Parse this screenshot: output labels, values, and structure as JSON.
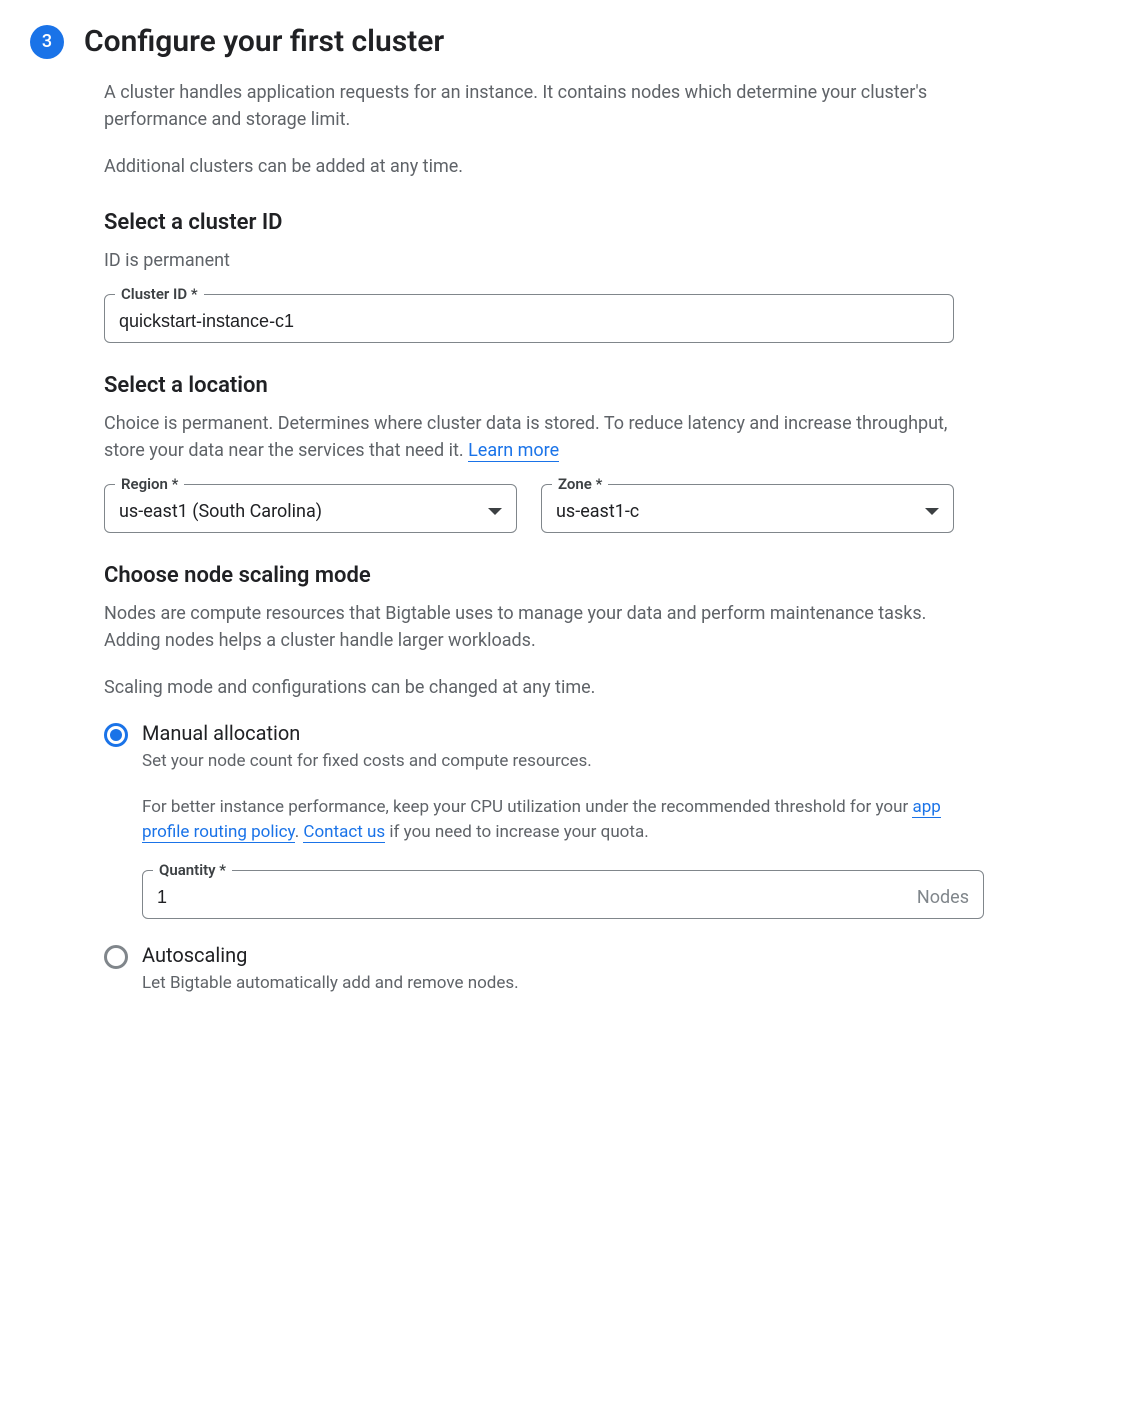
{
  "step": {
    "number": "3",
    "title": "Configure your first cluster"
  },
  "intro": {
    "desc1": "A cluster handles application requests for an instance. It contains nodes which determine your cluster's performance and storage limit.",
    "desc2": "Additional clusters can be added at any time."
  },
  "clusterId": {
    "heading": "Select a cluster ID",
    "subtext": "ID is permanent",
    "label": "Cluster ID *",
    "value": "quickstart-instance-c1"
  },
  "location": {
    "heading": "Select a location",
    "subtext_prefix": "Choice is permanent. Determines where cluster data is stored. To reduce latency and increase throughput, store your data near the services that need it. ",
    "learn_more": "Learn more",
    "region_label": "Region *",
    "region_value": "us-east1 (South Carolina)",
    "zone_label": "Zone *",
    "zone_value": "us-east1-c"
  },
  "scaling": {
    "heading": "Choose node scaling mode",
    "desc1": "Nodes are compute resources that Bigtable uses to manage your data and perform maintenance tasks. Adding nodes helps a cluster handle larger workloads.",
    "desc2": "Scaling mode and configurations can be changed at any time.",
    "manual": {
      "label": "Manual allocation",
      "desc": "Set your node count for fixed costs and compute resources.",
      "extra_prefix": "For better instance performance, keep your CPU utilization under the recommended threshold for your ",
      "link1": "app profile routing policy",
      "extra_middle": ". ",
      "link2": "Contact us",
      "extra_suffix": " if you need to increase your quota.",
      "quantity_label": "Quantity *",
      "quantity_value": "1",
      "quantity_suffix": "Nodes"
    },
    "autoscaling": {
      "label": "Autoscaling",
      "desc": "Let Bigtable automatically add and remove nodes."
    }
  }
}
